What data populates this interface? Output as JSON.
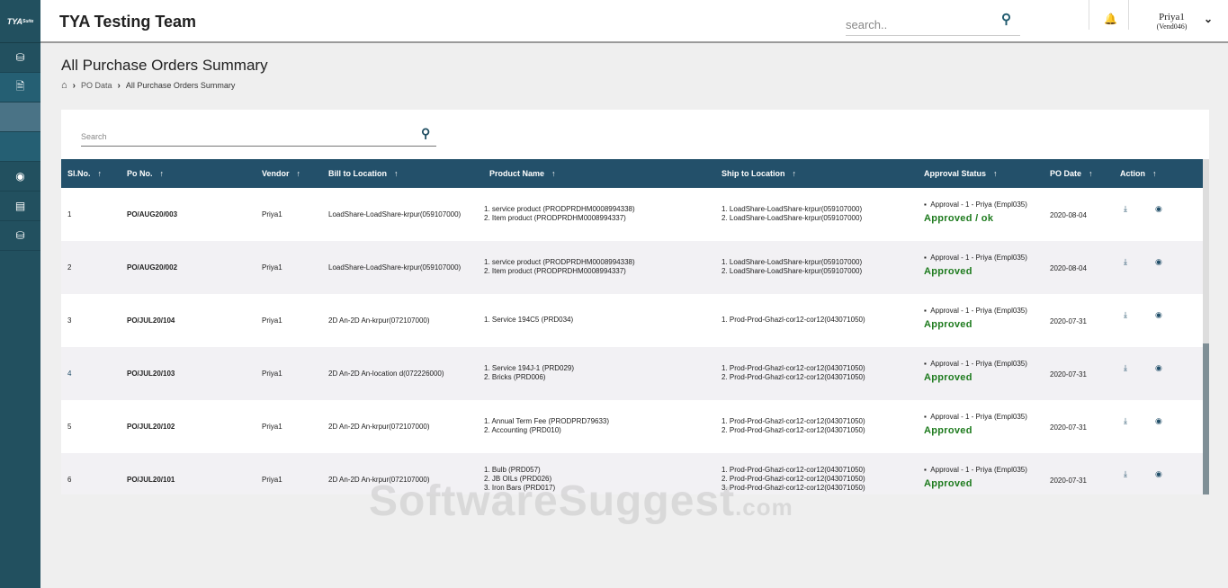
{
  "sidebar": {
    "logo": "TYA Suite",
    "items": [
      {
        "icon": "database-icon"
      },
      {
        "icon": "document-icon"
      },
      {
        "icon": "blank"
      },
      {
        "icon": "blank"
      },
      {
        "icon": "location-user-icon"
      },
      {
        "icon": "receipt-icon"
      },
      {
        "icon": "database-edit-icon"
      }
    ]
  },
  "header": {
    "title": "TYA Testing Team",
    "search_placeholder": "search..",
    "user_name": "Priya1",
    "user_id": "(Vend046)"
  },
  "page": {
    "title": "All Purchase Orders Summary",
    "breadcrumb": [
      "PO Data",
      "All Purchase Orders Summary"
    ]
  },
  "table": {
    "search_placeholder": "Search",
    "columns": [
      "Sl.No.",
      "Po No.",
      "Vendor",
      "Bill to Location",
      "Product Name",
      "Ship to Location",
      "Approval Status",
      "PO Date",
      "Action"
    ],
    "rows": [
      {
        "sl": "1",
        "po": "PO/AUG20/003",
        "vendor": "Priya1",
        "bill": "LoadShare-LoadShare-krpur(059107000)",
        "products": [
          "1. service product (PRODPRDHM0008994338)",
          "2. Item product (PRODPRDHM0008994337)"
        ],
        "ship": [
          "1. LoadShare-LoadShare-krpur(059107000)",
          "2. LoadShare-LoadShare-krpur(059107000)"
        ],
        "approver": "Approval - 1 - Priya (Empl035)",
        "status": "Approved / ok",
        "date": "2020-08-04"
      },
      {
        "sl": "2",
        "po": "PO/AUG20/002",
        "vendor": "Priya1",
        "bill": "LoadShare-LoadShare-krpur(059107000)",
        "products": [
          "1. service product (PRODPRDHM0008994338)",
          "2. Item product (PRODPRDHM0008994337)"
        ],
        "ship": [
          "1. LoadShare-LoadShare-krpur(059107000)",
          "2. LoadShare-LoadShare-krpur(059107000)"
        ],
        "approver": "Approval - 1 - Priya (Empl035)",
        "status": "Approved",
        "date": "2020-08-04"
      },
      {
        "sl": "3",
        "po": "PO/JUL20/104",
        "vendor": "Priya1",
        "bill": "2D An-2D An-krpur(072107000)",
        "products": [
          "1. Service 194C5 (PRD034)"
        ],
        "ship": [
          "1. Prod-Prod-Ghazl-cor12-cor12(043071050)"
        ],
        "approver": "Approval - 1 - Priya (Empl035)",
        "status": "Approved",
        "date": "2020-07-31"
      },
      {
        "sl": "4",
        "po": "PO/JUL20/103",
        "vendor": "Priya1",
        "bill": "2D An-2D An-location d(072226000)",
        "products": [
          "1. Service 194J-1 (PRD029)",
          "2. Bricks (PRD006)"
        ],
        "ship": [
          "1. Prod-Prod-Ghazl-cor12-cor12(043071050)",
          "2. Prod-Prod-Ghazl-cor12-cor12(043071050)"
        ],
        "approver": "Approval - 1 - Priya (Empl035)",
        "status": "Approved",
        "date": "2020-07-31"
      },
      {
        "sl": "5",
        "po": "PO/JUL20/102",
        "vendor": "Priya1",
        "bill": "2D An-2D An-krpur(072107000)",
        "products": [
          "1. Annual Term Fee (PRODPRD79633)",
          "2. Accounting (PRD010)"
        ],
        "ship": [
          "1. Prod-Prod-Ghazl-cor12-cor12(043071050)",
          "2. Prod-Prod-Ghazl-cor12-cor12(043071050)"
        ],
        "approver": "Approval - 1 - Priya (Empl035)",
        "status": "Approved",
        "date": "2020-07-31"
      },
      {
        "sl": "6",
        "po": "PO/JUL20/101",
        "vendor": "Priya1",
        "bill": "2D An-2D An-krpur(072107000)",
        "products": [
          "1. Bulb (PRD057)",
          "2. JB OILs (PRD026)",
          "3. Iron Bars (PRD017)"
        ],
        "ship": [
          "1. Prod-Prod-Ghazl-cor12-cor12(043071050)",
          "2. Prod-Prod-Ghazl-cor12-cor12(043071050)",
          "3. Prod-Prod-Ghazl-cor12-cor12(043071050)"
        ],
        "approver": "Approval - 1 - Priya (Empl035)",
        "status": "Approved",
        "date": "2020-07-31"
      }
    ]
  },
  "colors": {
    "sidebar": "#22505f",
    "table_header": "#23506a",
    "approved": "#1e7b1e"
  },
  "watermark": "SoftwareSuggest.com"
}
